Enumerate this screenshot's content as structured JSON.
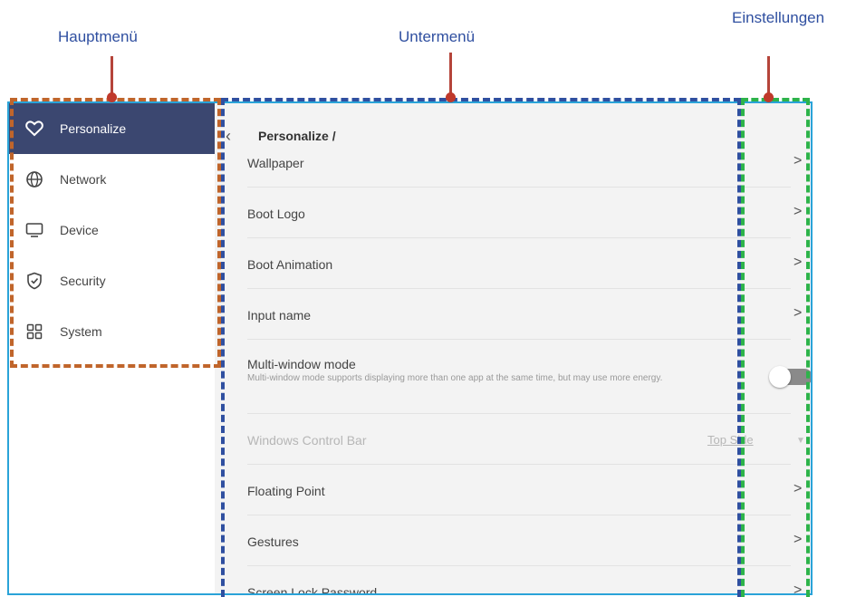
{
  "callouts": {
    "main_menu": "Hauptmenü",
    "sub_menu": "Untermenü",
    "settings": "Einstellungen"
  },
  "colors": {
    "main_menu_box": "#c0652b",
    "sub_menu_box": "#2f4fa0",
    "settings_box": "#2db34a",
    "screen_border": "#2aa3d8",
    "active_nav_bg": "#3b4770"
  },
  "sidebar": {
    "items": [
      {
        "label": "Personalize",
        "icon": "heart-icon",
        "active": true
      },
      {
        "label": "Network",
        "icon": "globe-icon",
        "active": false
      },
      {
        "label": "Device",
        "icon": "monitor-icon",
        "active": false
      },
      {
        "label": "Security",
        "icon": "shield-check-icon",
        "active": false
      },
      {
        "label": "System",
        "icon": "grid-icon",
        "active": false
      }
    ]
  },
  "main": {
    "back_icon": "chevron-left-icon",
    "breadcrumb": "Personalize /",
    "rows": [
      {
        "label": "Wallpaper"
      },
      {
        "label": "Boot Logo"
      },
      {
        "label": "Boot Animation"
      },
      {
        "label": "Input name"
      },
      {
        "label": "Multi-window mode",
        "description": "Multi-window mode supports displaying more than one app at the same time, but may use more energy.",
        "toggle": "off"
      },
      {
        "label": "Windows Control Bar",
        "value": "Top Side",
        "disabled": true
      },
      {
        "label": "Floating Point"
      },
      {
        "label": "Gestures"
      },
      {
        "label": "Screen Lock Password"
      }
    ],
    "chevron": ">",
    "dropdown_arrow": "▼"
  }
}
